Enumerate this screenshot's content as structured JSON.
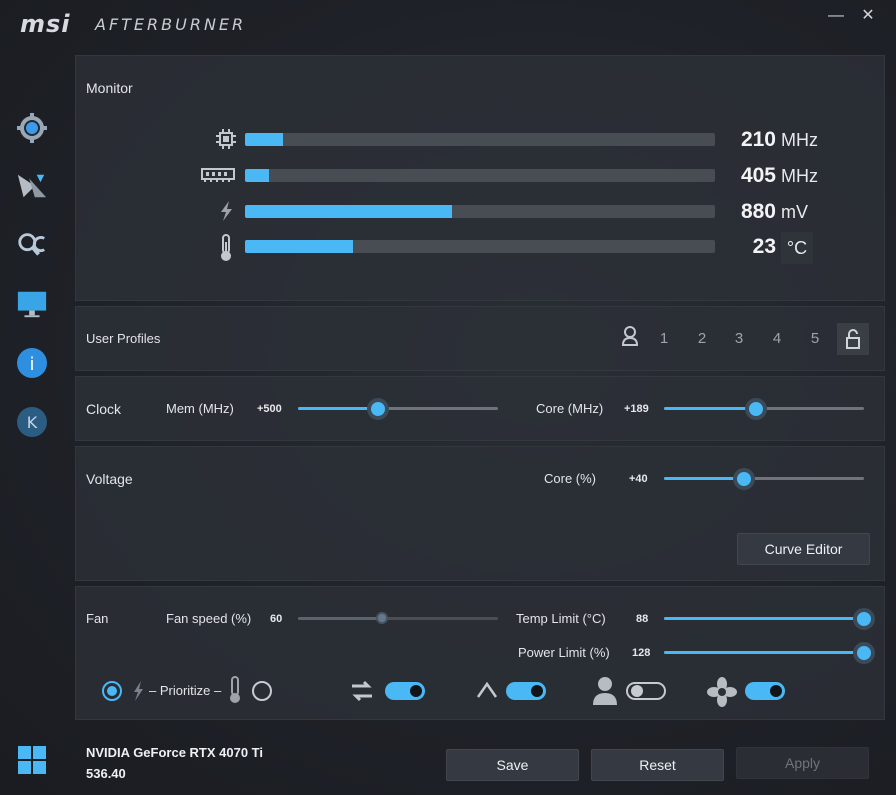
{
  "app": {
    "logo": "msi",
    "title": "AFTERBURNER",
    "minimize": "—",
    "close": "✕"
  },
  "sidebar": {
    "items": [
      {
        "name": "settings",
        "icon": "gear-icon"
      },
      {
        "name": "oc-scanner",
        "icon": "scanner-icon"
      },
      {
        "name": "hardware-monitor",
        "icon": "search-icon"
      },
      {
        "name": "display",
        "icon": "monitor-icon"
      },
      {
        "name": "info",
        "icon": "info-icon",
        "label": "i"
      },
      {
        "name": "kombustor",
        "icon": "k-icon",
        "label": "K"
      }
    ]
  },
  "monitor": {
    "title": "Monitor",
    "rows": [
      {
        "id": "gpu-clock",
        "icon": "chip-icon",
        "value": "210",
        "unit": "MHz",
        "level": 0.08
      },
      {
        "id": "mem-clock",
        "icon": "memory-icon",
        "value": "405",
        "unit": "MHz",
        "level": 0.05
      },
      {
        "id": "voltage",
        "icon": "lightning-icon",
        "value": "880",
        "unit": "mV",
        "level": 0.44
      },
      {
        "id": "temperature",
        "icon": "thermometer-icon",
        "value": "23",
        "unit": "°C",
        "level": 0.23
      }
    ]
  },
  "profiles": {
    "title": "User Profiles",
    "slots": [
      "1",
      "2",
      "3",
      "4",
      "5"
    ]
  },
  "clock": {
    "title": "Clock",
    "mem_label": "Mem (MHz)",
    "mem_value": "+500",
    "mem_level": 0.4,
    "core_label": "Core (MHz)",
    "core_value": "+189",
    "core_level": 0.46
  },
  "voltage": {
    "title": "Voltage",
    "core_label": "Core (%)",
    "core_value": "+40",
    "core_level": 0.4,
    "curve_editor": "Curve Editor"
  },
  "fan": {
    "title": "Fan",
    "speed_label": "Fan speed (%)",
    "speed_value": "60",
    "speed_level": 0.42,
    "temp_label": "Temp Limit (°C)",
    "temp_value": "88",
    "temp_level": 1.0,
    "power_label": "Power Limit (%)",
    "power_value": "128",
    "power_level": 1.0,
    "prioritize": "– Prioritize –",
    "toggles": [
      {
        "name": "sync-toggle",
        "icon": "sync-arrows-icon",
        "on": true
      },
      {
        "name": "auto-toggle",
        "icon": "auto-icon",
        "on": true
      },
      {
        "name": "user-toggle",
        "icon": "user-icon",
        "on": false
      },
      {
        "name": "fan-auto-toggle",
        "icon": "fan-icon",
        "on": true
      }
    ]
  },
  "footer": {
    "gpu_name": "NVIDIA GeForce RTX 4070 Ti",
    "driver": "536.40",
    "save": "Save",
    "reset": "Reset",
    "apply": "Apply"
  },
  "colors": {
    "accent": "#4ab8f4",
    "background": "#1d2026",
    "panel": "#2c3037"
  }
}
